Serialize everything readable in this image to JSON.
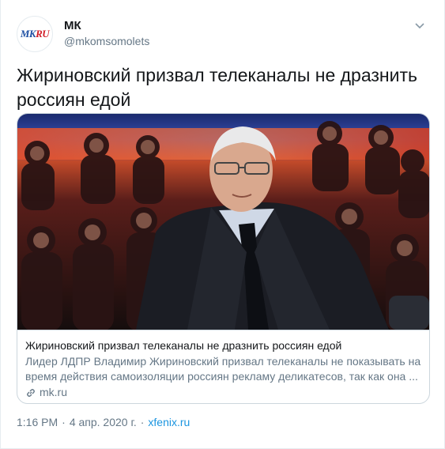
{
  "author": {
    "display_name": "МК",
    "handle": "@mkomsomolets",
    "avatar_logo": {
      "part1": "MK",
      "part2": "RU"
    }
  },
  "tweet_text": "Жириновский призвал телеканалы не дразнить россиян едой",
  "card": {
    "title": "Жириновский призвал телеканалы не дразнить россиян едой",
    "description": "Лидер ЛДПР Владимир Жириновский призвал телеканалы не показывать на время действия самоизоляции россиян рекламу деликатесов, так как она ...",
    "domain": "mk.ru",
    "image_icon": "photo-of-politician-in-tv-studio"
  },
  "footer": {
    "time": "1:16 PM",
    "separator": "·",
    "date": "4 апр. 2020 г.",
    "source": "xfenix.ru"
  },
  "colors": {
    "text": "#14171a",
    "muted": "#657786",
    "link": "#1b95e0",
    "border": "#ccd6dd"
  },
  "icons": {
    "caret": "chevron-down-icon",
    "link": "link-icon"
  }
}
